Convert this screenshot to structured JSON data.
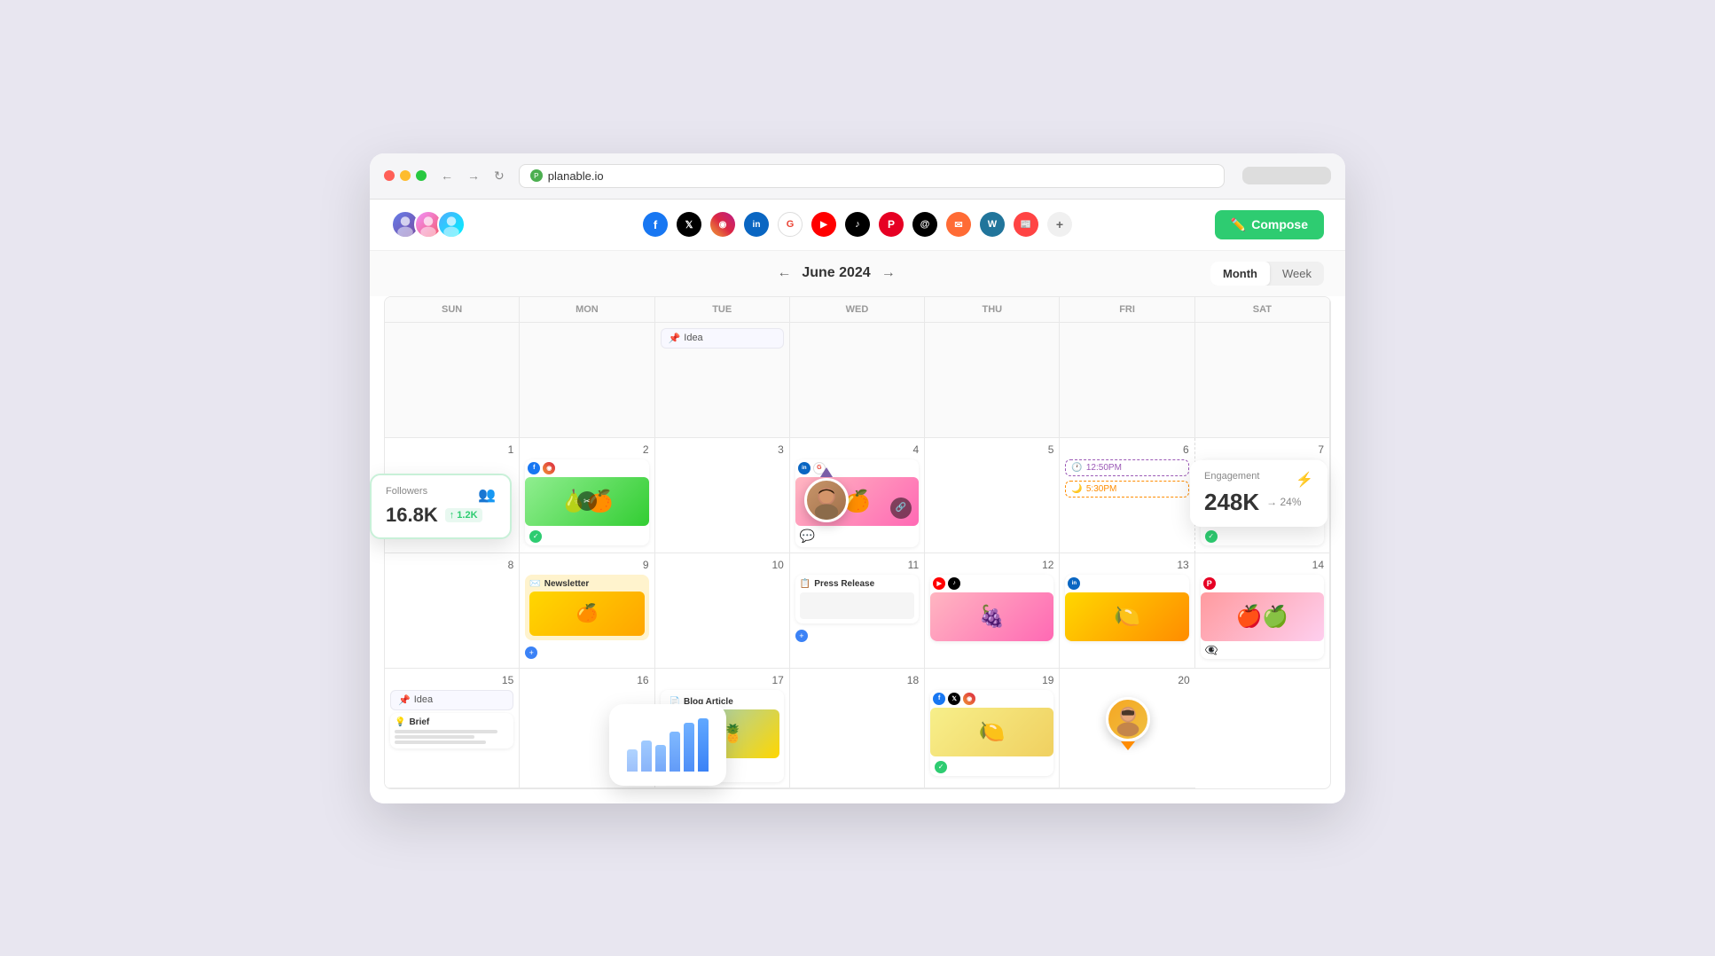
{
  "browser": {
    "url": "planable.io",
    "back_label": "←",
    "forward_label": "→",
    "refresh_label": "↻"
  },
  "header": {
    "compose_label": "Compose",
    "social_icons": [
      {
        "id": "facebook",
        "label": "f",
        "class": "facebook"
      },
      {
        "id": "twitter",
        "label": "𝕏",
        "class": "twitter"
      },
      {
        "id": "instagram",
        "label": "◉",
        "class": "instagram"
      },
      {
        "id": "linkedin",
        "label": "in",
        "class": "linkedin"
      },
      {
        "id": "google",
        "label": "G",
        "class": "google"
      },
      {
        "id": "youtube",
        "label": "▶",
        "class": "youtube"
      },
      {
        "id": "tiktok",
        "label": "♪",
        "class": "tiktok"
      },
      {
        "id": "pinterest",
        "label": "P",
        "class": "pinterest"
      },
      {
        "id": "threads",
        "label": "@",
        "class": "threads"
      },
      {
        "id": "email",
        "label": "✉",
        "class": "email"
      },
      {
        "id": "wordpress",
        "label": "W",
        "class": "wordpress"
      },
      {
        "id": "news",
        "label": "📰",
        "class": "news"
      },
      {
        "id": "add",
        "label": "+",
        "class": "add"
      }
    ]
  },
  "calendar": {
    "title": "June 2024",
    "prev_label": "←",
    "next_label": "→",
    "view_month": "Month",
    "view_week": "Week",
    "day_headers": [
      "Sun",
      "Mon",
      "Tue",
      "Wed",
      "Thu",
      "Fri",
      "Sat"
    ],
    "cells": [
      {
        "day": "",
        "type": "empty"
      },
      {
        "day": "",
        "type": "empty"
      },
      {
        "day": "",
        "type": "empty"
      },
      {
        "day": "",
        "type": "empty"
      },
      {
        "day": "",
        "type": "empty"
      },
      {
        "day": "",
        "type": "empty"
      },
      {
        "day": "",
        "type": "empty"
      },
      {
        "day": "1",
        "content": "empty_day"
      },
      {
        "day": "2",
        "content": "fruit_card_fb_ig"
      },
      {
        "day": "3",
        "content": "empty_day"
      },
      {
        "day": "4",
        "content": "pink_orange_card"
      },
      {
        "day": "5",
        "content": "empty_day"
      },
      {
        "day": "6",
        "content": "time_chips"
      },
      {
        "day": "",
        "type": "end_row"
      },
      {
        "day": "7",
        "content": "gif_card"
      },
      {
        "day": "8",
        "content": "empty_day"
      },
      {
        "day": "9",
        "content": "newsletter_card"
      },
      {
        "day": "10",
        "content": "empty_day"
      },
      {
        "day": "11",
        "content": "press_release"
      },
      {
        "day": "12",
        "content": "yt_tk_card"
      },
      {
        "day": "13",
        "content": "orange_card_li"
      },
      {
        "day": "14",
        "content": "apple_card"
      },
      {
        "day": "15",
        "content": "idea_brief"
      },
      {
        "day": "16",
        "content": "empty_day"
      },
      {
        "day": "17",
        "content": "blog_article"
      },
      {
        "day": "18",
        "content": "chip_card_19"
      },
      {
        "day": "19",
        "content": "fb_tw_ig_card"
      },
      {
        "day": "20",
        "content": "man_card"
      }
    ]
  },
  "widgets": {
    "followers": {
      "label": "Followers",
      "value": "16.8K",
      "change": "↑ 1.2K"
    },
    "engagement": {
      "label": "Engagement",
      "value": "248K",
      "change": "→ 24%"
    }
  },
  "cards": {
    "idea_label": "Idea",
    "newsletter_label": "Newsletter",
    "press_release_label": "Press Release",
    "blog_article_label": "Blog Article",
    "idea2_label": "Idea",
    "brief_label": "Brief",
    "time1": "12:50PM",
    "time2": "5:30PM"
  }
}
